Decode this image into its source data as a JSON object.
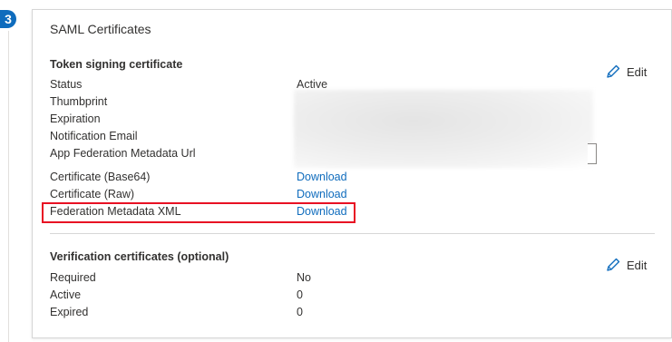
{
  "step": {
    "number": "3"
  },
  "card": {
    "title": "SAML Certificates"
  },
  "token_signing": {
    "title": "Token signing certificate",
    "edit_label": "Edit",
    "rows": {
      "status": {
        "label": "Status",
        "value": "Active"
      },
      "thumbprint": {
        "label": "Thumbprint"
      },
      "expiration": {
        "label": "Expiration"
      },
      "notification_email": {
        "label": "Notification Email"
      },
      "metadata_url": {
        "label": "App Federation Metadata Url"
      },
      "cert_base64": {
        "label": "Certificate (Base64)",
        "link": "Download"
      },
      "cert_raw": {
        "label": "Certificate (Raw)",
        "link": "Download"
      },
      "federation_xml": {
        "label": "Federation Metadata XML",
        "link": "Download"
      }
    }
  },
  "verification": {
    "title": "Verification certificates (optional)",
    "edit_label": "Edit",
    "rows": {
      "required": {
        "label": "Required",
        "value": "No"
      },
      "active": {
        "label": "Active",
        "value": "0"
      },
      "expired": {
        "label": "Expired",
        "value": "0"
      }
    }
  },
  "colors": {
    "accent": "#0f6cbd",
    "highlight": "#e81123",
    "text": "#323130"
  },
  "icons": {
    "edit": "pencil-icon"
  }
}
